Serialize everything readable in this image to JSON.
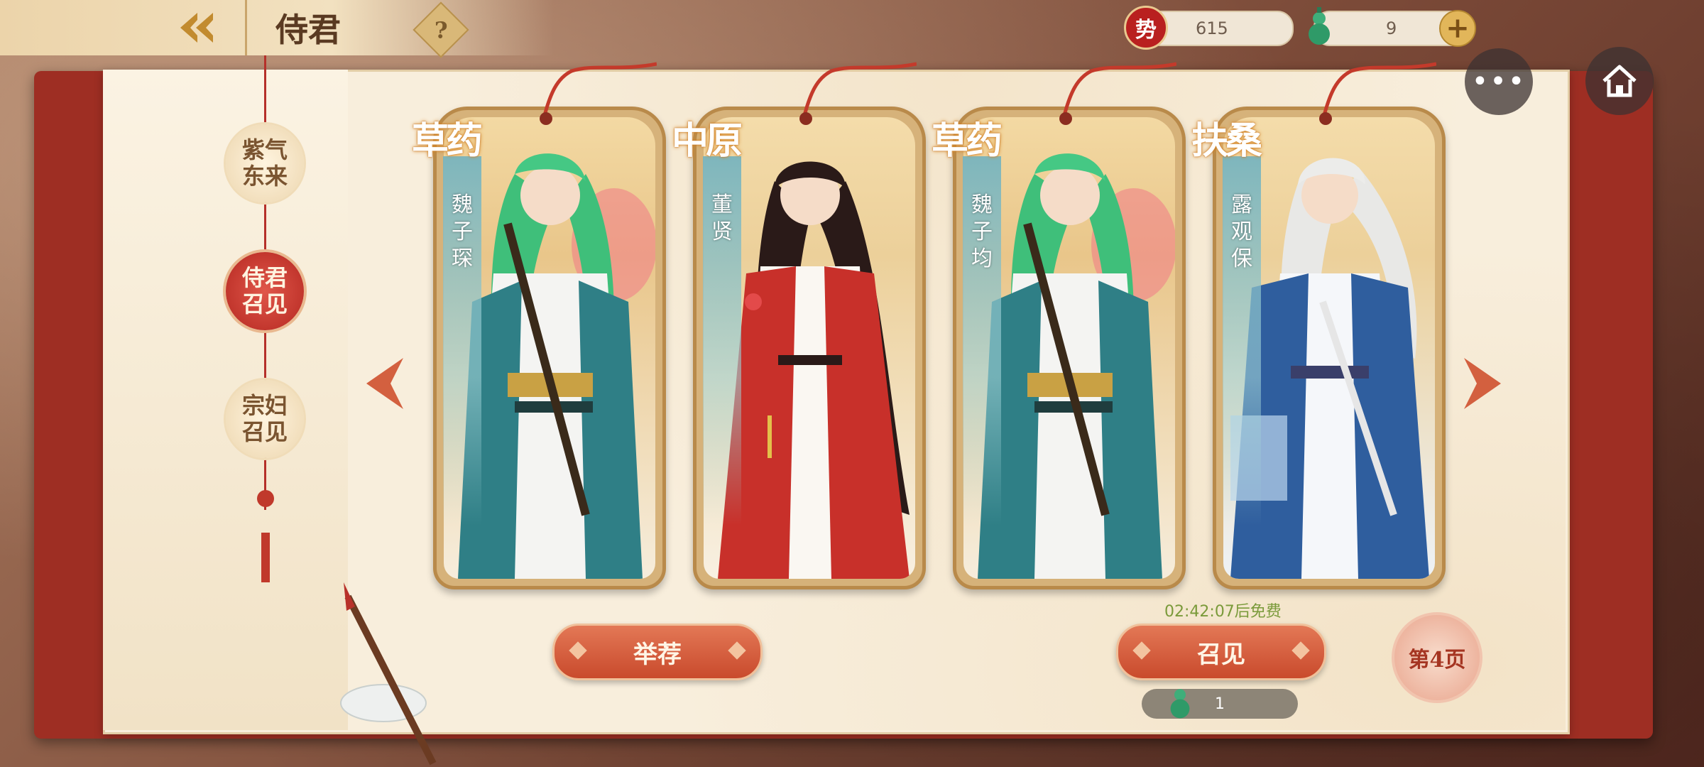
{
  "header": {
    "title": "侍君",
    "help_label": "?"
  },
  "resources": {
    "power": {
      "icon": "势",
      "value": "615"
    },
    "jade": {
      "value": "9"
    }
  },
  "side_tabs": [
    {
      "label": "紫气\n东来",
      "active": false
    },
    {
      "label": "侍君\n召见",
      "active": true
    },
    {
      "label": "宗妇\n召见",
      "active": false
    }
  ],
  "cards": [
    {
      "faction": "草药",
      "name": "魏子琛",
      "theme": "green"
    },
    {
      "faction": "中原",
      "name": "董贤",
      "theme": "red"
    },
    {
      "faction": "草药",
      "name": "魏子均",
      "theme": "green"
    },
    {
      "faction": "扶桑",
      "name": "露观保",
      "theme": "blue"
    }
  ],
  "actions": {
    "recommend_label": "举荐",
    "summon_label": "召见",
    "free_timer": "02:42:07后免费",
    "summon_cost": "1",
    "page_label": "第4页"
  },
  "colors": {
    "accent_red": "#c94a2c",
    "gold": "#d6b27a",
    "timer_green": "#7a9a3a"
  }
}
